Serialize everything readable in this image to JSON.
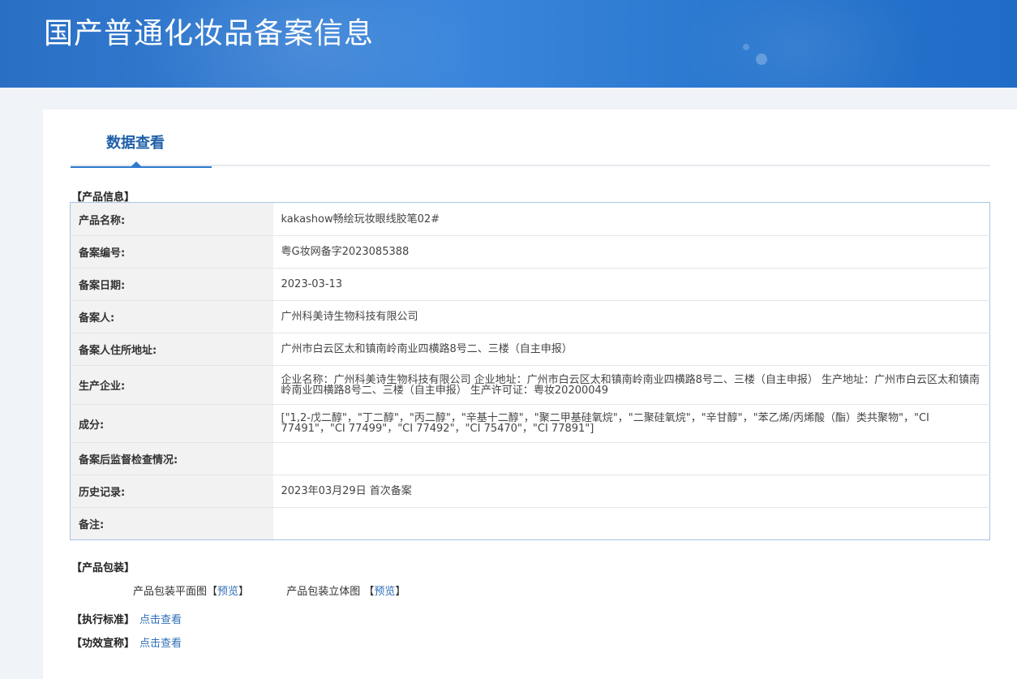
{
  "header": {
    "title": "国产普通化妆品备案信息"
  },
  "tabs": [
    {
      "label": "数据查看"
    }
  ],
  "sections": {
    "product_info": "【产品信息】",
    "product_packaging": "【产品包装】",
    "standard": "【执行标准】",
    "efficacy": "【功效宣称】"
  },
  "product_table": [
    {
      "key": "产品名称:",
      "value": "kakashow畅绘玩妆眼线胶笔02#"
    },
    {
      "key": "备案编号:",
      "value": "粤G妆网备字2023085388"
    },
    {
      "key": "备案日期:",
      "value": "2023-03-13"
    },
    {
      "key": "备案人:",
      "value": "广州科美诗生物科技有限公司"
    },
    {
      "key": "备案人住所地址:",
      "value": "广州市白云区太和镇南岭南业四横路8号二、三楼（自主申报）"
    },
    {
      "key": "生产企业:",
      "value": "企业名称：广州科美诗生物科技有限公司 企业地址：广州市白云区太和镇南岭南业四横路8号二、三楼（自主申报） 生产地址：广州市白云区太和镇南岭南业四横路8号二、三楼（自主申报） 生产许可证：粤妆20200049"
    },
    {
      "key": "成分:",
      "value": "[\"1,2-戊二醇\"，\"丁二醇\"，\"丙二醇\"，\"辛基十二醇\"，\"聚二甲基硅氧烷\"，\"二聚硅氧烷\"，\"辛甘醇\"，\"苯乙烯/丙烯酸（酯）类共聚物\"，\"CI 77491\"，\"CI 77499\"，\"CI 77492\"，\"CI 75470\"，\"CI 77891\"]"
    },
    {
      "key": "备案后监督检查情况:",
      "value": ""
    },
    {
      "key": "历史记录:",
      "value": "2023年03月29日 首次备案"
    },
    {
      "key": "备注:",
      "value": ""
    }
  ],
  "packaging": {
    "flat_label": "产品包装平面图",
    "solid_label": "产品包装立体图",
    "preview_link": "预览",
    "bracket_open": "【",
    "bracket_close": "】"
  },
  "links": {
    "view": "点击查看"
  },
  "colors": {
    "banner": "#2a78d0",
    "accent": "#1f5fa8",
    "link": "#2f6fb7",
    "table_border": "#a8c4e4"
  }
}
